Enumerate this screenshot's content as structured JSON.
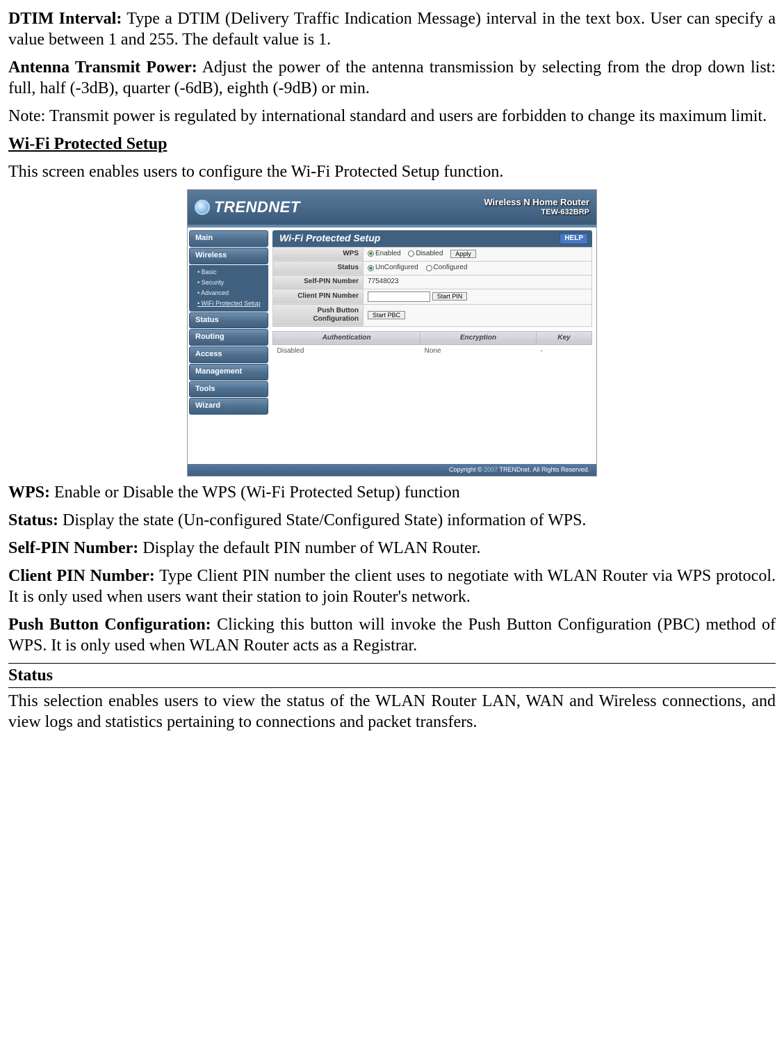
{
  "doc": {
    "p1": {
      "b": "DTIM Interval:",
      "t": " Type a DTIM (Delivery Traffic Indication Message) interval in the text box. User can specify a value between 1 and 255. The default value is 1."
    },
    "p2": {
      "b": "Antenna Transmit Power:",
      "t": " Adjust the power of the antenna transmission by selecting from the drop down list: full, half (-3dB), quarter (-6dB), eighth (-9dB) or min."
    },
    "p3": "Note: Transmit power is regulated by international standard and users are forbidden to change its maximum limit.",
    "h1": "Wi-Fi Protected Setup",
    "p4": "This screen enables users to configure the Wi-Fi Protected Setup function.",
    "p5": {
      "b": "WPS:",
      "t": " Enable or Disable the WPS (Wi-Fi Protected Setup) function"
    },
    "p6": {
      "b": "Status:",
      "t": " Display the state (Un-configured State/Configured State) information of WPS."
    },
    "p7": {
      "b": "Self-PIN Number:",
      "t": " Display the default PIN number of WLAN Router."
    },
    "p8": {
      "b": "Client PIN Number:",
      "t": " Type Client PIN number the client uses to negotiate with WLAN Router via WPS protocol. It is only used when users want their station to join Router's network."
    },
    "p9": {
      "b": "Push Button Configuration:",
      "t": " Clicking this button will invoke the Push Button Configuration (PBC) method of WPS. It is only used when WLAN Router acts as a Registrar."
    },
    "h2": "Status",
    "p10": "This selection enables users to view the status of the WLAN Router LAN, WAN and Wireless connections, and view logs and statistics pertaining to connections and packet transfers."
  },
  "router": {
    "brand": "TRENDNET",
    "header_title": "Wireless N Home Router",
    "header_model": "TEW-632BRP",
    "nav": {
      "main": "Main",
      "wireless": "Wireless",
      "status": "Status",
      "routing": "Routing",
      "access": "Access",
      "management": "Management",
      "tools": "Tools",
      "wizard": "Wizard",
      "sub": {
        "basic": "Basic",
        "security": "Security",
        "advanced": "Advanced",
        "wps": "WiFi Protected Setup"
      }
    },
    "panel": {
      "title": "Wi-Fi Protected Setup",
      "help": "HELP",
      "labels": {
        "wps": "WPS",
        "status": "Status",
        "self_pin": "Self-PIN Number",
        "client_pin": "Client PIN Number",
        "pbc": "Push Button Configuration"
      },
      "values": {
        "wps_enabled_lbl": "Enabled",
        "wps_disabled_lbl": "Disabled",
        "apply_btn": "Apply",
        "status_unconf_lbl": "UnConfigured",
        "status_conf_lbl": "Configured",
        "self_pin_value": "77548023",
        "client_pin_value": "",
        "start_pin_btn": "Start PIN",
        "start_pbc_btn": "Start PBC"
      },
      "table": {
        "headers": {
          "auth": "Authentication",
          "enc": "Encryption",
          "key": "Key"
        },
        "row": {
          "auth": "Disabled",
          "enc": "None",
          "key": "-"
        }
      }
    },
    "footer": {
      "prefix": "Copyright © ",
      "year": "2007",
      "suffix": " TRENDnet. All Rights Reserved."
    }
  }
}
